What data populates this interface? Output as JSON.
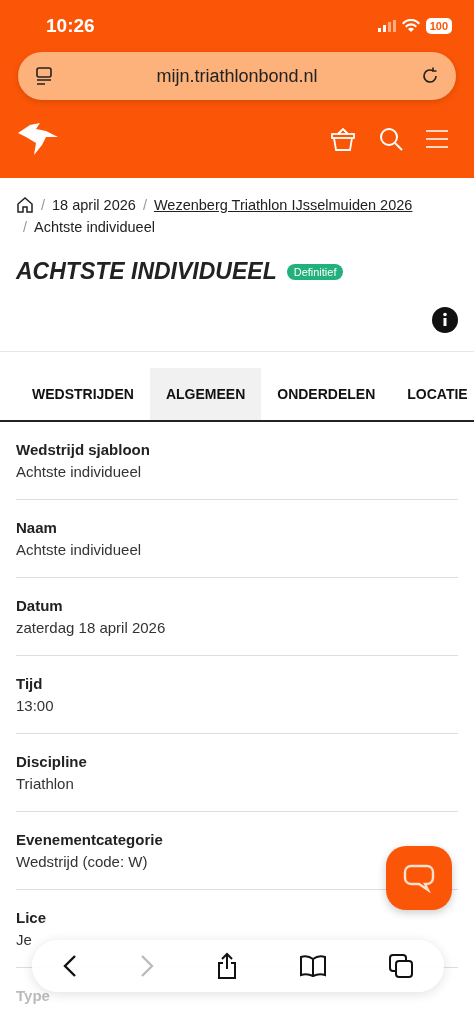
{
  "status_bar": {
    "time": "10:26",
    "battery": "100"
  },
  "browser": {
    "url": "mijn.triathlonbond.nl"
  },
  "breadcrumb": [
    {
      "separator": "/",
      "label": "18 april 2026",
      "link": false
    },
    {
      "separator": "/",
      "label": "Wezenberg Triathlon IJsselmuiden 2026",
      "link": true
    },
    {
      "separator": "/",
      "label": "Achtste individueel",
      "link": false
    }
  ],
  "page": {
    "title": "ACHTSTE INDIVIDUEEL",
    "badge": "Definitief"
  },
  "tabs": [
    {
      "label": "WEDSTRIJDEN",
      "selected": false
    },
    {
      "label": "ALGEMEEN",
      "selected": true
    },
    {
      "label": "ONDERDELEN",
      "selected": false
    },
    {
      "label": "LOCATIE",
      "selected": false
    }
  ],
  "fields": [
    {
      "label": "Wedstrijd sjabloon",
      "value": "Achtste individueel"
    },
    {
      "label": "Naam",
      "value": "Achtste individueel"
    },
    {
      "label": "Datum",
      "value": "zaterdag 18 april 2026"
    },
    {
      "label": "Tijd",
      "value": "13:00"
    },
    {
      "label": "Discipline",
      "value": "Triathlon"
    },
    {
      "label": "Evenementcategorie",
      "value": "Wedstrijd (code: W)"
    },
    {
      "label": "Lice",
      "value": "Je"
    },
    {
      "label": "Type"
    }
  ]
}
